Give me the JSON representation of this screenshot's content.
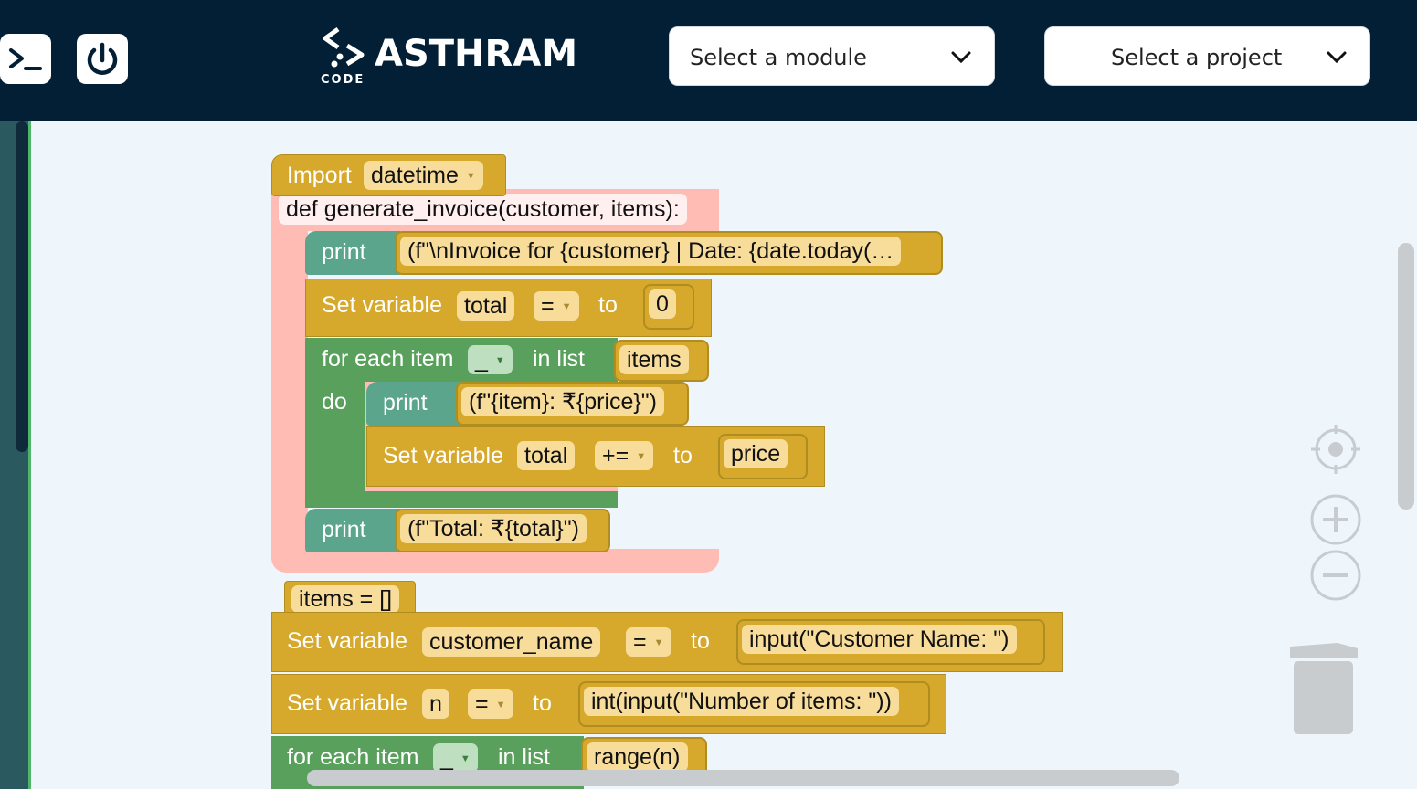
{
  "header": {
    "terminal_icon": "terminal-icon",
    "power_icon": "power-icon",
    "logo_text": "ASTHRAM",
    "logo_sub": "CODE",
    "module_select": {
      "value": "Select a module"
    },
    "project_select": {
      "value": "Select a project"
    }
  },
  "blocks": {
    "import_label": "Import",
    "import_module": "datetime",
    "def_line": "def generate_invoice(customer, items):",
    "print_label": "print",
    "print1_arg": "(f\"\\nInvoice for {customer} | Date: {date.today(…",
    "set_label": "Set variable",
    "to_label": "to",
    "set1_var": "total",
    "set1_op": "=",
    "set1_val": "0",
    "for_label": "for each item",
    "in_list_label": "in list",
    "do_label": "do",
    "for1_var": "_",
    "for1_list": "items",
    "print2_arg": "(f\"{item}: ₹{price}\")",
    "set2_var": "total",
    "set2_op": "+=",
    "set2_val": "price",
    "print3_arg": "(f\"Total: ₹{total}\")",
    "items_init": "items = []",
    "set3_var": "customer_name",
    "set3_op": "=",
    "set3_val": "input(\"Customer Name: \")",
    "set4_var": "n",
    "set4_op": "=",
    "set4_val": "int(input(\"Number of items: \"))",
    "for2_var": "_",
    "for2_list": "range(n)"
  },
  "workspace_controls": {
    "recenter_icon": "crosshair-icon",
    "zoom_in_icon": "zoom-in-icon",
    "zoom_out_icon": "zoom-out-icon",
    "trash_icon": "trash-icon"
  },
  "colors": {
    "header_bg": "#021f36",
    "block_gold": "#d6a82c",
    "block_teal": "#5ba58c",
    "block_green": "#58a05c",
    "block_pink": "#ffbcb5",
    "workspace_bg": "#eef6fc"
  }
}
